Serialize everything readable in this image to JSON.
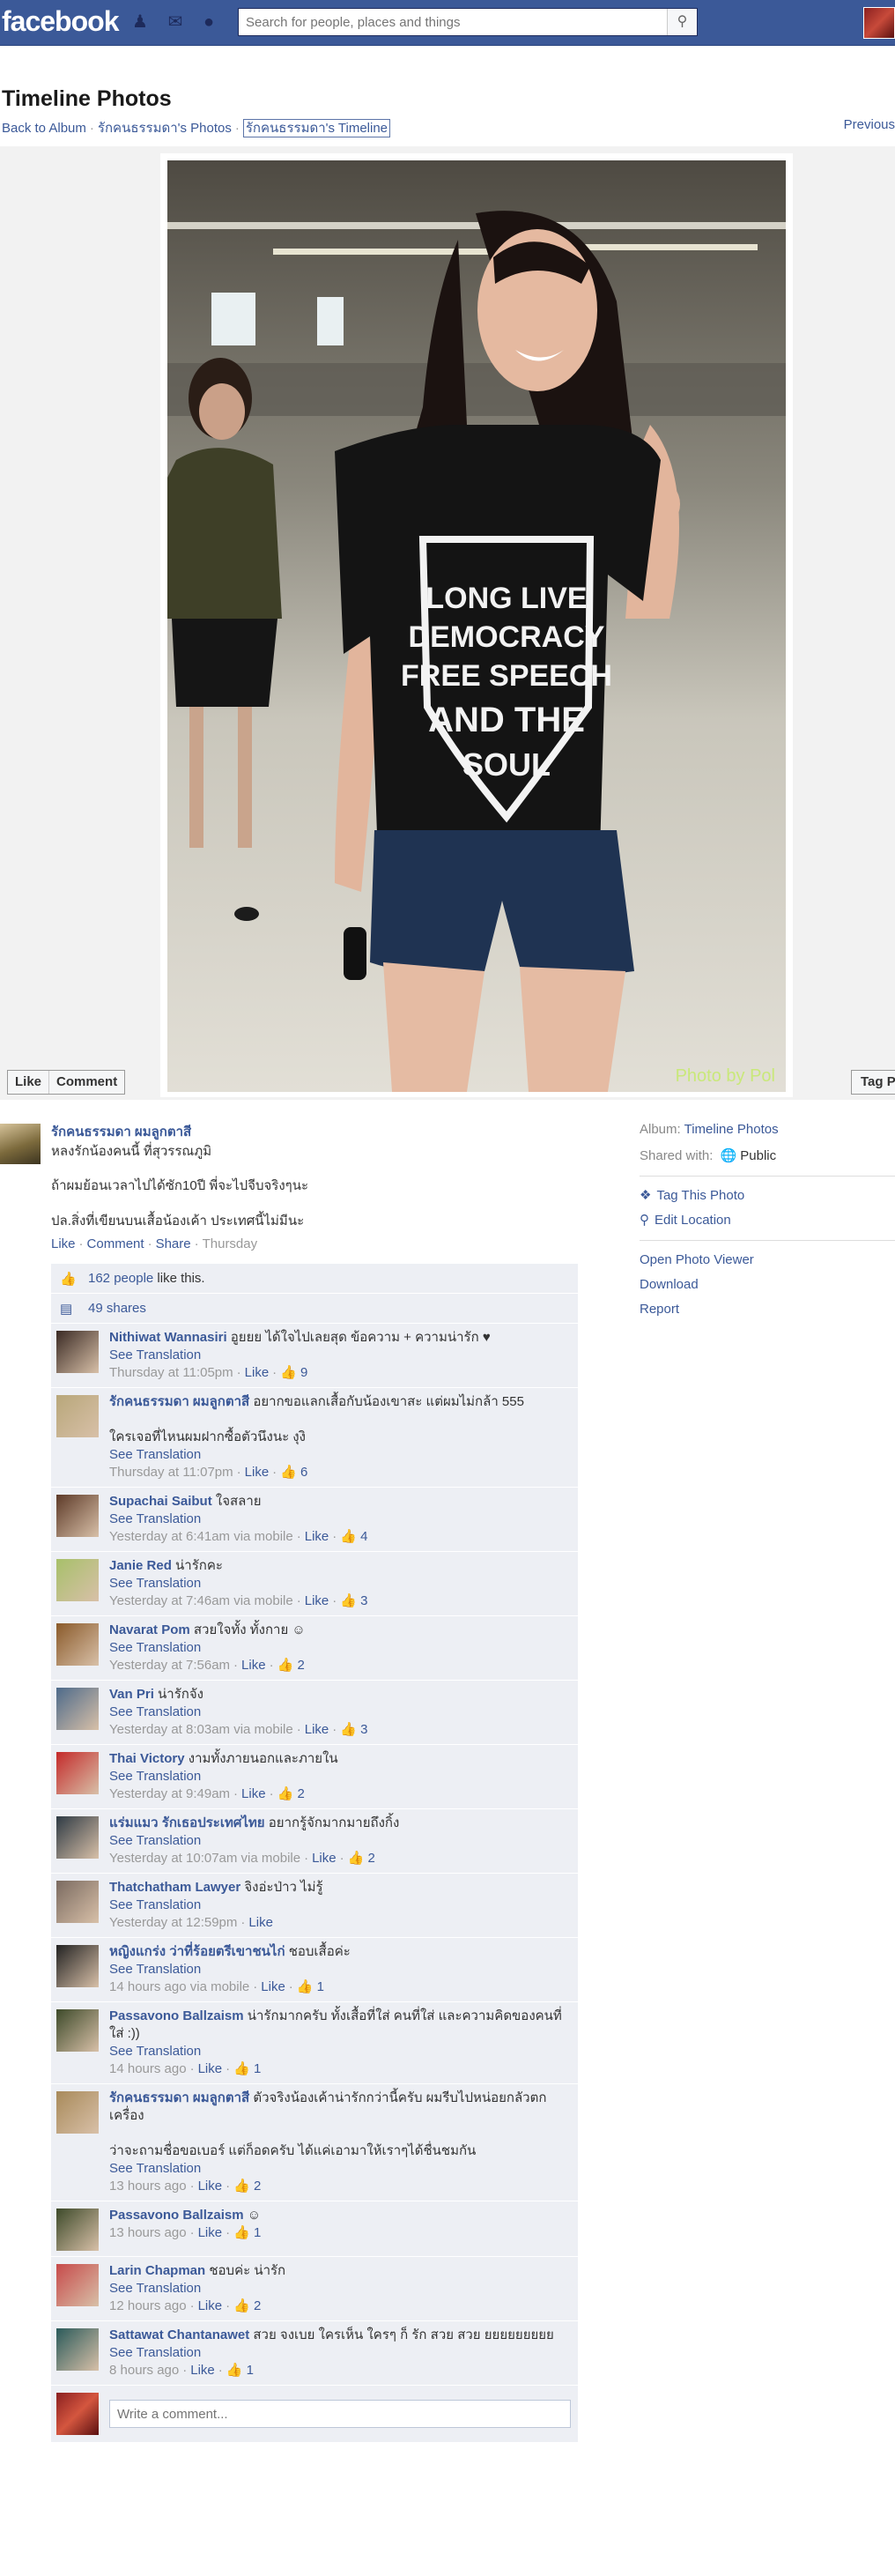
{
  "topbar": {
    "logo": "facebook",
    "search_placeholder": "Search for people, places and things",
    "icons": [
      "friends-icon",
      "messages-icon",
      "notifications-icon",
      "search-icon"
    ]
  },
  "page": {
    "title": "Timeline Photos",
    "crumbs": [
      "Back to Album",
      "รักคนธรรมดา's Photos",
      "รักคนธรรมดา's Timeline"
    ],
    "previous": "Previous"
  },
  "photo": {
    "shirt_lines": [
      "LONG LIVE",
      "DEMOCRACY",
      "FREE SPEECH",
      "AND THE",
      "SOUL"
    ],
    "watermark": "Photo by Pol"
  },
  "photo_actions": {
    "like": "Like",
    "comment": "Comment",
    "tag": "Tag Photo"
  },
  "post": {
    "owner": "รักคนธรรมดา ผมลูกตาสี",
    "location": "หลงรักน้องคนนี้ ที่สุวรรณภูมิ",
    "caption1": "ถ้าผมย้อนเวลาไปได้ซัก10ปี พี่จะไปจีบจริงๆนะ",
    "caption2": "ปล.สิ่งที่เขียนบนเสื้อน้องเค้า ประเทศนี้ไม่มีนะ",
    "actions": {
      "like": "Like",
      "comment": "Comment",
      "share": "Share",
      "time": "Thursday"
    }
  },
  "ufi": {
    "likes_count": "162 people",
    "likes_suffix": " like this.",
    "shares": "49 shares"
  },
  "comments": [
    {
      "author": "Nithiwat Wannasiri",
      "text": "อูยยย ได้ใจไปเลยสุด ข้อความ + ความน่ารัก ♥",
      "translate": "See Translation",
      "time": "Thursday at 11:05pm",
      "like": "Like",
      "likes": "9"
    },
    {
      "author": "รักคนธรรมดา ผมลูกตาสี",
      "text": "อยากขอแลกเสื้อกับน้องเขาสะ แต่ผมไม่กล้า 555",
      "text2": "ใครเจอที่ไหนผมฝากซื้อตัวนึงนะ งุงิ",
      "translate": "See Translation",
      "time": "Thursday at 11:07pm",
      "like": "Like",
      "likes": "6"
    },
    {
      "author": "Supachai Saibut",
      "text": "ใจสลาย",
      "translate": "See Translation",
      "time": "Yesterday at 6:41am via mobile",
      "like": "Like",
      "likes": "4"
    },
    {
      "author": "Janie Red",
      "text": "น่ารักคะ",
      "translate": "See Translation",
      "time": "Yesterday at 7:46am via mobile",
      "like": "Like",
      "likes": "3"
    },
    {
      "author": "Navarat Pom",
      "text": "สวยใจทั้ง ทั้งกาย ☺",
      "translate": "See Translation",
      "time": "Yesterday at 7:56am",
      "like": "Like",
      "likes": "2"
    },
    {
      "author": "Van Pri",
      "text": "น่ารักจัง",
      "translate": "See Translation",
      "time": "Yesterday at 8:03am via mobile",
      "like": "Like",
      "likes": "3"
    },
    {
      "author": "Thai Victory",
      "text": "งามทั้งภายนอกและภายใน",
      "translate": "See Translation",
      "time": "Yesterday at 9:49am",
      "like": "Like",
      "likes": "2"
    },
    {
      "author": "แร่มแมว รักเธอประเทศไทย",
      "text": "อยากรู้จักมากมายถึงกิ้ง",
      "translate": "See Translation",
      "time": "Yesterday at 10:07am via mobile",
      "like": "Like",
      "likes": "2"
    },
    {
      "author": "Thatchatham Lawyer",
      "text": "จิงอ่ะป่าว ไม่รู้",
      "translate": "See Translation",
      "time": "Yesterday at 12:59pm",
      "like": "Like",
      "likes": ""
    },
    {
      "author": "หญิงแกร่ง ว่าที่ร้อยตรีเขาชนไก่",
      "text": "ชอบเสื้อค่ะ",
      "translate": "See Translation",
      "time": "14 hours ago via mobile",
      "like": "Like",
      "likes": "1"
    },
    {
      "author": "Passavono Ballzaism",
      "text": "น่ารักมากครับ ทั้งเสื้อที่ใส่ คนที่ใส่ และความคิดของคนที่ใส่ :))",
      "translate": "See Translation",
      "time": "14 hours ago",
      "like": "Like",
      "likes": "1"
    },
    {
      "author": "รักคนธรรมดา ผมลูกตาสี",
      "text": "ตัวจริงน้องเค้าน่ารักกว่านี้ครับ ผมรีบไปหน่อยกลัวตกเครื่อง",
      "text2": "ว่าจะถามชื่อขอเบอร์ แต่ก็อดครับ ได้แค่เอามาให้เราๆได้ชื่นชมกัน",
      "translate": "See Translation",
      "time": "13 hours ago",
      "like": "Like",
      "likes": "2"
    },
    {
      "author": "Passavono Ballzaism",
      "text": "☺",
      "translate": "",
      "time": "13 hours ago",
      "like": "Like",
      "likes": "1"
    },
    {
      "author": "Larin Chapman",
      "text": "ชอบค่ะ น่ารัก",
      "translate": "See Translation",
      "time": "12 hours ago",
      "like": "Like",
      "likes": "2"
    },
    {
      "author": "Sattawat Chantanawet",
      "text": "สวย จงเบย ใครเห็น ใครๆ ก็ รัก สวย สวย ยยยยยยยยย",
      "translate": "See Translation",
      "time": "8 hours ago",
      "like": "Like",
      "likes": "1"
    }
  ],
  "write_placeholder": "Write a comment...",
  "side": {
    "album_label": "Album:",
    "album_value": "Timeline Photos",
    "shared_label": "Shared with:",
    "shared_value": "Public",
    "tag": "Tag This Photo",
    "edit_location": "Edit Location",
    "open_viewer": "Open Photo Viewer",
    "download": "Download",
    "report": "Report"
  }
}
